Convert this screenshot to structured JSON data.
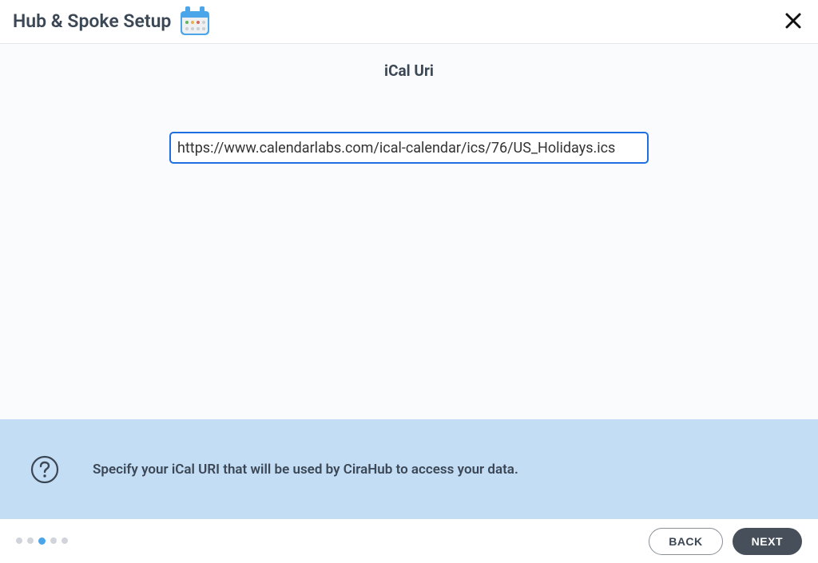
{
  "header": {
    "title": "Hub & Spoke Setup",
    "icon": "calendar-icon"
  },
  "main": {
    "section_title": "iCal Uri",
    "uri_value": "https://www.calendarlabs.com/ical-calendar/ics/76/US_Holidays.ics"
  },
  "help": {
    "text": "Specify your iCal URI that will be used by CiraHub to access your data."
  },
  "footer": {
    "back_label": "BACK",
    "next_label": "NEXT",
    "step_count": 5,
    "active_step_index": 2
  },
  "colors": {
    "accent": "#4aa6e8",
    "focus_border": "#1f6fe0",
    "help_band": "#c3ddf5",
    "text_dark": "#3c4755",
    "btn_dark": "#474f5b"
  }
}
